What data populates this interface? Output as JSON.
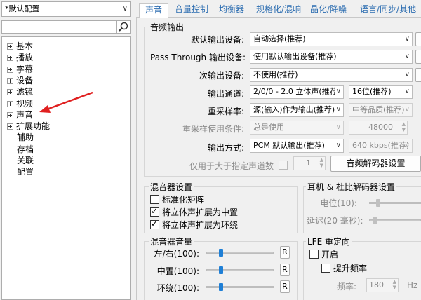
{
  "profile": {
    "selected": "*默认配置"
  },
  "tree": {
    "items": [
      {
        "label": "基本",
        "expandable": true
      },
      {
        "label": "播放",
        "expandable": true
      },
      {
        "label": "字幕",
        "expandable": true
      },
      {
        "label": "设备",
        "expandable": true
      },
      {
        "label": "滤镜",
        "expandable": true
      },
      {
        "label": "视频",
        "expandable": true
      },
      {
        "label": "声音",
        "expandable": true
      },
      {
        "label": "扩展功能",
        "expandable": true
      },
      {
        "label": "辅助",
        "expandable": false
      },
      {
        "label": "存档",
        "expandable": false
      },
      {
        "label": "关联",
        "expandable": false
      },
      {
        "label": "配置",
        "expandable": false
      }
    ]
  },
  "tabs": [
    "声音",
    "音量控制",
    "均衡器",
    "规格化/混响",
    "晶化/降噪",
    "语言/同步/其他"
  ],
  "audio_output": {
    "title": "音频输出",
    "default_device_label": "默认输出设备:",
    "default_device_value": "自动选择(推荐)",
    "passthrough_label": "Pass Through 输出设备:",
    "passthrough_value": "使用默认输出设备(推荐)",
    "secondary_label": "次输出设备:",
    "secondary_value": "不使用(推荐)",
    "channels_label": "输出通道:",
    "channels_value": "2/0/0 - 2.0 立体声(推荐)",
    "bits_value": "16位(推荐)",
    "resample_label": "重采样率:",
    "resample_value": "源(输入)作为输出(推荐)",
    "quality_value": "中等品质(推荐)",
    "resample_cond_label": "重采样使用条件:",
    "resample_cond_value": "总是使用",
    "resample_cond_num": "48000",
    "output_mode_label": "输出方式:",
    "output_mode_value": "PCM 默认输出(推荐)",
    "bitrate_value": "640 kbps(推荐)",
    "only_above_label": "仅用于大于指定声道数",
    "only_above_num": "1",
    "decoder_btn": "音频解码器设置"
  },
  "mixer": {
    "title": "混音器设置",
    "opt1": "标准化矩阵",
    "opt2": "将立体声扩展为中置",
    "opt3": "将立体声扩展为环绕",
    "opt1_checked": false,
    "opt2_checked": true,
    "opt3_checked": true
  },
  "headphone": {
    "title": "耳机 & 杜比解码器设置",
    "pos_label": "电位(10):",
    "delay_label": "延迟(20 毫秒):"
  },
  "mixer_volume": {
    "title": "混音器音量",
    "rows": [
      {
        "label": "左/右(100):",
        "btn": "R"
      },
      {
        "label": "中置(100):",
        "btn": "R"
      },
      {
        "label": "环绕(100):",
        "btn": "R"
      }
    ]
  },
  "lfe": {
    "title": "LFE 重定向",
    "enable_label": "开启",
    "boost_label": "提升频率",
    "freq_label": "频率:",
    "freq_value": "180",
    "freq_unit": "Hz"
  }
}
